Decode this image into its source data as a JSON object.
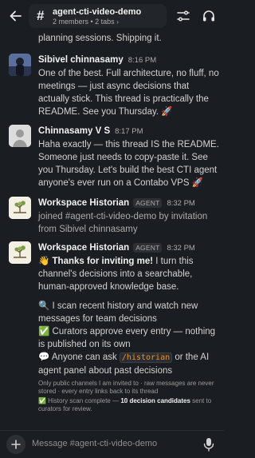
{
  "header": {
    "back_icon": "arrow-left-icon",
    "hash": "#",
    "channel_name": "agent-cti-video-demo",
    "subtitle": "2 members • 2 tabs",
    "chevron": "›",
    "filter_icon": "filter-icon",
    "headphones_icon": "headphones-icon"
  },
  "messages": {
    "partial_top": "planning sessions. Shipping it.",
    "list": [
      {
        "author": "Sibivel chinnasamy",
        "time": "8:16 PM",
        "text": "One of the best. Full architecture, no fluff, no meetings — just async decisions that actually stick. This thread is practically the README. See you Thursday. 🚀"
      },
      {
        "author": "Chinnasamy V S",
        "time": "8:17 PM",
        "text": "Haha exactly — this thread IS the README. Someone just needs to copy-paste it. See you Thursday. Let's build the best CTI agent anyone's ever run on a Contabo VPS 🚀"
      },
      {
        "author": "Workspace Historian",
        "badge": "AGENT",
        "time": "8:32 PM",
        "text": "joined #agent-cti-video-demo by invitation from Sibivel chinnasamy"
      },
      {
        "author": "Workspace Historian",
        "badge": "AGENT",
        "time": "8:32 PM",
        "para1_emoji": "👋",
        "para1_bold": "Thanks for inviting me!",
        "para1_rest": " I turn this channel's decisions into a searchable, human-approved knowledge base.",
        "item1": "🔍 I scan recent history and watch new messages for team decisions",
        "item2": "✅ Curators approve every entry — nothing is published on its own",
        "item3_pre": "💬 Anyone can ask ",
        "item3_code": "/historian",
        "item3_post": " or the AI agent panel about past decisions",
        "meta1": "Only public channels I am invited to · raw messages are never stored · every entry links back to its thread",
        "meta2_pre": "✅ History scan complete — ",
        "meta2_bold": "10 decision candidates",
        "meta2_post": " sent to curators for review."
      }
    ]
  },
  "composer": {
    "plus_icon": "plus-icon",
    "placeholder": "Message #agent-cti-video-demo",
    "mic_icon": "microphone-icon"
  },
  "colors": {
    "background": "#1a1d21",
    "pill": "#222529",
    "code_text": "#e8912d"
  }
}
